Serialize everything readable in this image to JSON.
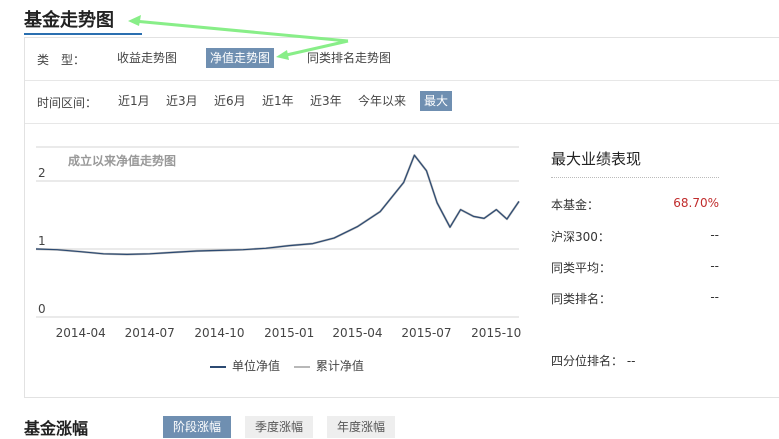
{
  "title": "基金走势图",
  "type_row": {
    "label": "类　型：",
    "options": [
      "收益走势图",
      "净值走势图",
      "同类排名走势图"
    ],
    "active": 1
  },
  "range_row": {
    "label": "时间区间：",
    "options": [
      "近1月",
      "近3月",
      "近6月",
      "近1年",
      "近3年",
      "今年以来",
      "最大"
    ],
    "active": 6
  },
  "chart_data": {
    "type": "line",
    "title": "成立以来净值走势图",
    "xlabel": "",
    "ylabel": "",
    "ylim": [
      0,
      2.5
    ],
    "y_ticks": [
      "0",
      "1",
      "2"
    ],
    "x_ticks": [
      "2014-04",
      "2014-07",
      "2014-10",
      "2015-01",
      "2015-04",
      "2015-07",
      "2015-10"
    ],
    "series": [
      {
        "name": "单位净值",
        "color": "#2c4a72",
        "x": [
          "2014-02-01",
          "2014-03-01",
          "2014-04-01",
          "2014-05-01",
          "2014-06-01",
          "2014-07-01",
          "2014-08-01",
          "2014-09-01",
          "2014-10-01",
          "2014-11-01",
          "2014-12-01",
          "2015-01-01",
          "2015-02-01",
          "2015-03-01",
          "2015-04-01",
          "2015-05-01",
          "2015-06-01",
          "2015-06-15",
          "2015-07-01",
          "2015-07-15",
          "2015-08-01",
          "2015-08-15",
          "2015-09-01",
          "2015-09-15",
          "2015-10-01",
          "2015-10-15",
          "2015-10-31"
        ],
        "y": [
          1.0,
          0.99,
          0.96,
          0.93,
          0.92,
          0.93,
          0.95,
          0.97,
          0.98,
          0.99,
          1.01,
          1.05,
          1.08,
          1.16,
          1.33,
          1.55,
          1.98,
          2.38,
          2.15,
          1.68,
          1.32,
          1.58,
          1.48,
          1.45,
          1.58,
          1.44,
          1.7
        ]
      },
      {
        "name": "累计净值",
        "color": "#b8b8b8",
        "x": [
          "2014-02-01",
          "2014-03-01",
          "2014-04-01",
          "2014-05-01",
          "2014-06-01",
          "2014-07-01",
          "2014-08-01",
          "2014-09-01",
          "2014-10-01",
          "2014-11-01",
          "2014-12-01",
          "2015-01-01",
          "2015-02-01",
          "2015-03-01",
          "2015-04-01",
          "2015-05-01",
          "2015-06-01",
          "2015-06-15",
          "2015-07-01",
          "2015-07-15",
          "2015-08-01",
          "2015-08-15",
          "2015-09-01",
          "2015-09-15",
          "2015-10-01",
          "2015-10-15",
          "2015-10-31"
        ],
        "y": [
          1.0,
          0.99,
          0.96,
          0.93,
          0.92,
          0.93,
          0.95,
          0.97,
          0.98,
          0.99,
          1.01,
          1.05,
          1.08,
          1.16,
          1.33,
          1.55,
          1.98,
          2.38,
          2.15,
          1.68,
          1.32,
          1.58,
          1.48,
          1.45,
          1.58,
          1.44,
          1.7
        ]
      }
    ],
    "legend": "bottom"
  },
  "performance": {
    "title": "最大业绩表现",
    "rows": [
      {
        "label": "本基金：",
        "value": "68.70%"
      },
      {
        "label": "沪深300：",
        "value": "--"
      },
      {
        "label": "同类平均：",
        "value": "--"
      },
      {
        "label": "同类排名：",
        "value": "--"
      }
    ],
    "quartile_label": "四分位排名：",
    "quartile_value": "--"
  },
  "bottom": {
    "title": "基金涨幅",
    "tabs": [
      "阶段涨幅",
      "季度涨幅",
      "年度涨幅"
    ],
    "active": 0
  },
  "colors": {
    "accent": "#6f8fb1",
    "annotation_arrow": "#88ee88",
    "positive": "#c02c2c"
  }
}
